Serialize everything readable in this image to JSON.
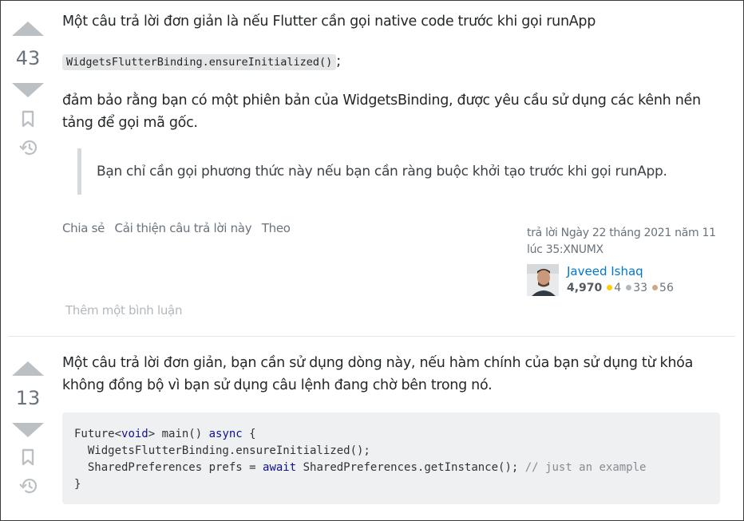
{
  "answers": [
    {
      "votes": "43",
      "intro": "Một câu trả lời đơn giản là nếu Flutter cần gọi native code trước khi gọi runApp",
      "inline_code": "WidgetsFlutterBinding.ensureInitialized()",
      "inline_code_suffix": ";",
      "body": "đảm bảo rằng bạn có một phiên bản của WidgetsBinding, được yêu cầu sử dụng các kênh nền tảng để gọi mã gốc.",
      "quote": "Bạn chỉ cần gọi phương thức này nếu bạn cần ràng buộc khởi tạo trước khi gọi runApp.",
      "menu": {
        "share": "Chia sẻ",
        "improve": "Cải thiện câu trả lời này",
        "follow": "Theo"
      },
      "answered": "trả lời Ngày 22 tháng 2021 năm 11 lúc 35:XNUMX",
      "user": {
        "name": "Javeed Ishaq",
        "rep": "4,970",
        "gold": "4",
        "silver": "33",
        "bronze": "56"
      },
      "add_comment": "Thêm một bình luận"
    },
    {
      "votes": "13",
      "intro": "Một câu trả lời đơn giản, bạn cần sử dụng dòng này, nếu hàm chính của bạn sử dụng từ khóa không đồng bộ vì bạn sử dụng câu lệnh đang chờ bên trong nó.",
      "code": {
        "l1_a": "Future<",
        "l1_kw": "void",
        "l1_b": "> main() ",
        "l1_kw2": "async",
        "l1_c": " {",
        "l2": "  WidgetsFlutterBinding.ensureInitialized();",
        "l3_a": "  SharedPreferences prefs = ",
        "l3_kw": "await",
        "l3_b": " SharedPreferences.getInstance(); ",
        "l3_cm": "// just an example",
        "l4": "}"
      }
    }
  ],
  "icons": {
    "upvote": "arrow-up-icon",
    "downvote": "arrow-down-icon",
    "bookmark": "bookmark-icon",
    "history": "history-icon"
  },
  "colors": {
    "link": "#0077cc",
    "gold": "#ffcc01",
    "silver": "#b4b8bc",
    "bronze": "#d1a684",
    "vote_arrow": "#bbc0c4"
  }
}
